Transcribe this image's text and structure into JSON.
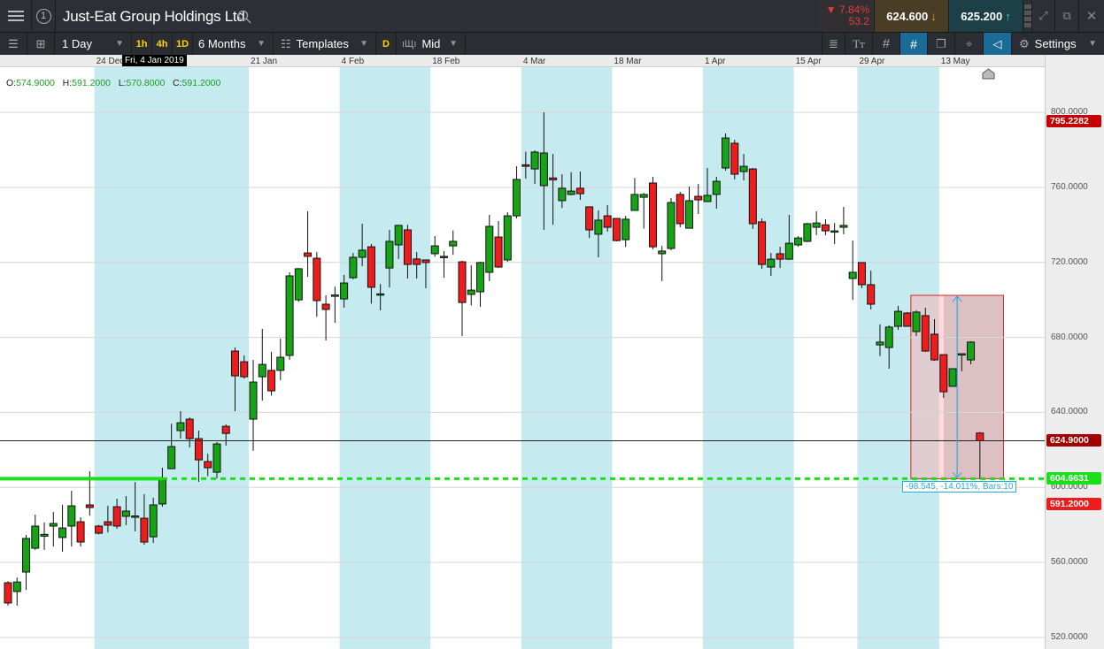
{
  "header": {
    "title": "Just-Eat Group Holdings Ltd",
    "slot_number": "1",
    "change_pct": "▼ 7.84%",
    "change_abs": "53.2",
    "sell_price": "624.600",
    "buy_price": "625.200"
  },
  "toolbar": {
    "interval": "1 Day",
    "quick_intervals": [
      "1h",
      "4h",
      "1D"
    ],
    "range": "6 Months",
    "templates": "Templates",
    "d_label": "D",
    "price_type": "Mid",
    "settings": "Settings",
    "tt_label": "Tт"
  },
  "hover": {
    "date": "Fri, 4 Jan 2019",
    "o_label": "O:",
    "o": "574.9000",
    "h_label": "H:",
    "h": "591.2000",
    "l_label": "L:",
    "l": "570.8000",
    "c_label": "C:",
    "c": "591.2000"
  },
  "tags": {
    "high": "795.2282",
    "current": "624.9000",
    "level": "604.6631",
    "hover_close": "591.2000"
  },
  "measure": {
    "label": "-98.545, -14.011%, Bars:10",
    "from_price": 702.4,
    "to_price": 604.6631,
    "start_bar": 99.5,
    "end_bar": 109.5
  },
  "colors": {
    "up": "#16a416",
    "down": "#ee1c1c",
    "band": "#c5eaf0",
    "level": "#19e019",
    "current_tag": "#a30000",
    "high_tag": "#c40000"
  },
  "chart_data": {
    "type": "candlestick",
    "title": "Just-Eat Group Holdings Ltd",
    "ylim": [
      520,
      800
    ],
    "yticks": [
      "800.0000",
      "760.0000",
      "720.0000",
      "680.0000",
      "640.0000",
      "600.0000",
      "560.0000",
      "520.0000"
    ],
    "ytick_values": [
      800,
      760,
      720,
      680,
      640,
      600,
      560,
      520
    ],
    "xticks": [
      {
        "label": "24 Dec",
        "bar": 10
      },
      {
        "label": "21 Jan",
        "bar": 27
      },
      {
        "label": "4 Feb",
        "bar": 37
      },
      {
        "label": "18 Feb",
        "bar": 47
      },
      {
        "label": "4 Mar",
        "bar": 57
      },
      {
        "label": "18 Mar",
        "bar": 67
      },
      {
        "label": "1 Apr",
        "bar": 77
      },
      {
        "label": "15 Apr",
        "bar": 87
      },
      {
        "label": "29 Apr",
        "bar": 94
      },
      {
        "label": "13 May",
        "bar": 103
      }
    ],
    "current_price": 624.9,
    "level": 604.6631,
    "ohlc": [
      [
        549.2,
        550,
        537,
        538.4
      ],
      [
        544.5,
        552,
        537,
        549.6
      ],
      [
        554.9,
        574.7,
        545.4,
        572.8
      ],
      [
        567.6,
        585.5,
        566.7,
        579.4
      ],
      [
        574,
        581.3,
        566.7,
        575
      ],
      [
        579.4,
        586.9,
        568.5,
        580.8
      ],
      [
        573.3,
        590.7,
        565.7,
        578.4
      ],
      [
        579.4,
        598.2,
        568.5,
        590.2
      ],
      [
        581.7,
        584.1,
        568.5,
        570.9
      ],
      [
        590.7,
        608.6,
        585,
        589.3
      ],
      [
        579.4,
        580,
        575,
        575.6
      ],
      [
        581.7,
        590.2,
        576,
        579.9
      ],
      [
        589.7,
        594,
        578,
        579.4
      ],
      [
        584.6,
        595.4,
        579.9,
        587.4
      ],
      [
        584.4,
        602.9,
        576.6,
        584.8
      ],
      [
        583.6,
        596.4,
        569.5,
        570.9
      ],
      [
        573.7,
        594.5,
        570.4,
        590.7
      ],
      [
        591.2,
        610.5,
        589.7,
        604.4
      ],
      [
        610,
        634,
        610,
        621.8
      ],
      [
        630.3,
        640.7,
        626,
        634.5
      ],
      [
        636.4,
        637.4,
        621.3,
        626
      ],
      [
        626,
        630.3,
        603,
        614.7
      ],
      [
        613.8,
        618,
        606,
        610.5
      ],
      [
        608.1,
        624.2,
        604.8,
        623.2
      ],
      [
        632.6,
        633.6,
        622.3,
        628.8
      ],
      [
        672.7,
        674.6,
        640.7,
        659.5
      ],
      [
        667,
        670.4,
        658,
        659
      ],
      [
        636.4,
        668,
        619.5,
        656.2
      ],
      [
        659,
        684.5,
        646.3,
        665.6
      ],
      [
        662.4,
        672.3,
        649,
        651.5
      ],
      [
        662.4,
        679.3,
        657.2,
        669.4
      ],
      [
        670.4,
        714.7,
        668,
        712.8
      ],
      [
        700,
        717,
        699,
        716.6
      ],
      [
        725,
        747.2,
        712.3,
        723.2
      ],
      [
        722.2,
        725.5,
        691,
        699.6
      ],
      [
        697.7,
        702.4,
        678.4,
        694.9
      ],
      [
        702.2,
        707,
        687.8,
        702.6
      ],
      [
        700.5,
        713.3,
        695.8,
        709
      ],
      [
        711.8,
        725,
        711,
        722.7
      ],
      [
        722.7,
        740.6,
        718,
        726.5
      ],
      [
        728.3,
        729.8,
        698,
        706.7
      ],
      [
        702.8,
        708.5,
        694.4,
        703.2
      ],
      [
        717,
        737.3,
        706.7,
        731.2
      ],
      [
        729.3,
        740,
        721.8,
        739.7
      ],
      [
        737.3,
        740,
        711.4,
        718.9
      ],
      [
        721.8,
        725.5,
        711.4,
        718.9
      ],
      [
        721.3,
        721.5,
        706.2,
        719.9
      ],
      [
        724.6,
        734,
        723,
        728.8
      ],
      [
        722.8,
        726,
        711.8,
        723.2
      ],
      [
        728.8,
        737,
        724,
        731.2
      ],
      [
        720.3,
        720.8,
        680.7,
        698.6
      ],
      [
        702.9,
        718.4,
        697,
        705.2
      ],
      [
        704.3,
        720.3,
        696.3,
        719.9
      ],
      [
        714.7,
        745.3,
        710,
        739.2
      ],
      [
        733.5,
        742,
        717,
        717.5
      ],
      [
        721.3,
        746.7,
        720.3,
        744.8
      ],
      [
        744.8,
        771.2,
        743.4,
        764.2
      ],
      [
        772,
        779,
        764.6,
        771.2
      ],
      [
        769.8,
        779.7,
        761.8,
        778.8
      ],
      [
        760.9,
        800,
        737.3,
        778.3
      ],
      [
        765,
        777.8,
        740,
        764
      ],
      [
        752.9,
        767,
        749,
        759.5
      ],
      [
        756.2,
        768,
        755.7,
        758
      ],
      [
        759.5,
        768.4,
        753.3,
        756.6
      ],
      [
        749.6,
        749.6,
        733,
        737.3
      ],
      [
        735,
        747.7,
        722.7,
        742.5
      ],
      [
        744.8,
        750.5,
        736.4,
        738.7
      ],
      [
        743.4,
        743.4,
        731.2,
        731.6
      ],
      [
        732.1,
        744.8,
        728.3,
        743
      ],
      [
        747.7,
        765,
        747.7,
        756.2
      ],
      [
        754.7,
        757,
        738,
        756.2
      ],
      [
        762.3,
        765.6,
        727,
        728.3
      ],
      [
        724.6,
        728.8,
        710,
        726
      ],
      [
        727.4,
        754.3,
        726.5,
        751.9
      ],
      [
        756.2,
        757.6,
        738.7,
        740.6
      ],
      [
        738.2,
        760.4,
        738,
        752.9
      ],
      [
        755.2,
        761.8,
        745.8,
        753.3
      ],
      [
        752.4,
        770.3,
        752.4,
        755.7
      ],
      [
        756.2,
        765.6,
        748.6,
        763.2
      ],
      [
        770.3,
        788.7,
        768.9,
        786.3
      ],
      [
        783.5,
        785.4,
        764.2,
        767
      ],
      [
        768.4,
        777.8,
        763.7,
        771.2
      ],
      [
        769.8,
        770.3,
        737.8,
        740.6
      ],
      [
        741.6,
        743.4,
        716.6,
        718.9
      ],
      [
        717.5,
        725,
        712.8,
        721.7
      ],
      [
        724.6,
        728.3,
        717,
        721.7
      ],
      [
        721.7,
        745.3,
        721.3,
        730.2
      ],
      [
        729.3,
        734,
        728.3,
        733
      ],
      [
        731.2,
        741,
        730.7,
        740.6
      ],
      [
        738.7,
        747.2,
        734.5,
        741
      ],
      [
        740,
        743,
        734.5,
        736.8
      ],
      [
        736.5,
        741,
        729.8,
        736.8
      ],
      [
        738.7,
        749.6,
        735,
        739.7
      ],
      [
        711.4,
        731.6,
        700,
        714.7
      ],
      [
        719.9,
        719.9,
        706.2,
        708.1
      ],
      [
        708.1,
        715.6,
        694.9,
        697.7
      ],
      [
        676,
        686.9,
        670,
        677.5
      ],
      [
        674.6,
        686.4,
        663.3,
        685.5
      ],
      [
        685.9,
        696.8,
        684,
        693.9
      ],
      [
        693,
        693.5,
        685.9,
        685.9
      ],
      [
        683.1,
        694.4,
        680.7,
        693.5
      ],
      [
        691.6,
        695.8,
        672.3,
        672.7
      ],
      [
        681.7,
        689.7,
        667.5,
        668
      ],
      [
        670.8,
        670.8,
        647.7,
        651
      ],
      [
        653.9,
        663.3,
        653.9,
        663.3
      ],
      [
        671,
        671.3,
        661.9,
        671.3
      ],
      [
        668,
        677.9,
        665.6,
        677.5
      ],
      [
        629,
        629.5,
        604.7,
        624.9
      ]
    ]
  }
}
